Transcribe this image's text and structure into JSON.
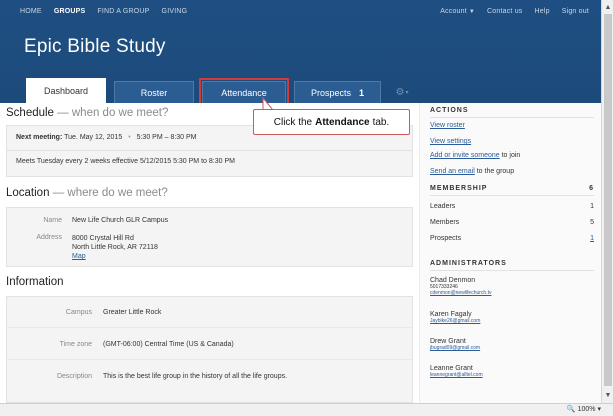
{
  "topnav": {
    "left": [
      "HOME",
      "GROUPS",
      "FIND A GROUP",
      "GIVING"
    ],
    "account": "Account",
    "right": [
      "Contact us",
      "Help",
      "Sign out"
    ]
  },
  "group_title": "Epic Bible Study",
  "tabs": {
    "dashboard": "Dashboard",
    "roster": "Roster",
    "attendance": "Attendance",
    "prospects": "Prospects",
    "prospects_count": "1"
  },
  "schedule": {
    "title": "Schedule",
    "subtitle": "— when do we meet?",
    "next_label": "Next meeting:",
    "next_date": "Tue. May 12, 2015",
    "next_time": "5:30 PM – 8:30 PM",
    "desc": "Meets Tuesday every 2 weeks effective 5/12/2015 5:30 PM to 8:30 PM"
  },
  "location": {
    "title": "Location",
    "subtitle": "— where do we meet?",
    "name_label": "Name",
    "name_value": "New Life Church GLR Campus",
    "address_label": "Address",
    "address_line1": "8000 Crystal Hill Rd",
    "address_line2": "North Little Rock, AR 72118",
    "map_link": "Map"
  },
  "information": {
    "title": "Information",
    "campus_label": "Campus",
    "campus_value": "Greater Little Rock",
    "tz_label": "Time zone",
    "tz_value": "(GMT-06:00) Central Time (US & Canada)",
    "desc_label": "Description",
    "desc_value": "This is the best life group in the history of all the life groups."
  },
  "sidebar": {
    "actions_head": "ACTIONS",
    "view_roster": "View roster",
    "view_settings": "View settings",
    "add_invite": "Add or invite someone",
    "add_invite_suffix": "to join",
    "send_email": "Send an email",
    "send_email_suffix": "to the group",
    "membership_head": "MEMBERSHIP",
    "membership_count": "6",
    "leaders_label": "Leaders",
    "leaders_count": "1",
    "members_label": "Members",
    "members_count": "5",
    "prospects_label": "Prospects",
    "prospects_count": "1",
    "admins_head": "ADMINISTRATORS",
    "admins": [
      {
        "name": "Chad Denmon",
        "phone": "5017333246",
        "email": "cdenmon@newlifechurch.tv"
      },
      {
        "name": "Karen Fagaly",
        "email": "Jaybike26@gmail.com"
      },
      {
        "name": "Drew Grant",
        "email": "jbugrad09@gmail.com"
      },
      {
        "name": "Leanne Grant",
        "email": "leannegrant@alltel.com"
      }
    ]
  },
  "callout": {
    "pre": "Click the",
    "strong": "Attendance",
    "post": "tab."
  },
  "status": {
    "zoom": "100%"
  }
}
